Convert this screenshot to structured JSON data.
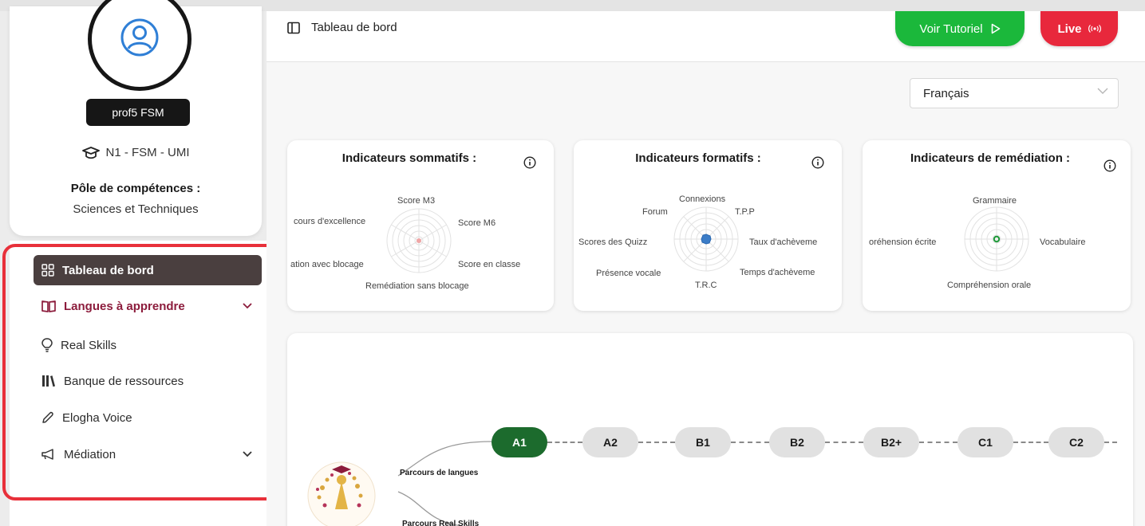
{
  "profile": {
    "username": "prof5 FSM",
    "level_text": "N1 - FSM - UMI",
    "pole_label": "Pôle de compétences :",
    "pole_value": "Sciences et Techniques"
  },
  "sidebar": {
    "items": [
      {
        "label": "Tableau de bord",
        "icon": "grid-icon"
      },
      {
        "label": "Langues à apprendre",
        "icon": "book-open-icon"
      },
      {
        "label": "Real Skills",
        "icon": "lightbulb-icon"
      },
      {
        "label": "Banque de ressources",
        "icon": "library-icon"
      },
      {
        "label": "Elogha Voice",
        "icon": "pen-icon"
      },
      {
        "label": "Médiation",
        "icon": "megaphone-icon"
      }
    ]
  },
  "header": {
    "breadcrumb": "Tableau de bord",
    "tutorial_button": "Voir Tutoriel",
    "live_button": "Live",
    "language_select": "Français"
  },
  "indicators": [
    {
      "title": "Indicateurs sommatifs :",
      "axes": [
        "Score M3",
        "Score M6",
        "Score en classe",
        "Remédiation sans blocage",
        "ation avec blocage",
        "cours d'excellence"
      ]
    },
    {
      "title": "Indicateurs formatifs :",
      "axes": [
        "Connexions",
        "T.P.P",
        "Taux d'achèveme",
        "Temps d'achèveme",
        "T.R.C",
        "Présence vocale",
        "Scores des Quizz",
        "Forum"
      ]
    },
    {
      "title": "Indicateurs de remédiation :",
      "axes": [
        "Grammaire",
        "Vocabulaire",
        "Compréhension orale",
        "oréhension écrite"
      ]
    }
  ],
  "levels": [
    "A1",
    "A2",
    "B1",
    "B2",
    "B2+",
    "C1",
    "C2"
  ],
  "active_level": "A1",
  "paths": {
    "languages": "Parcours de langues",
    "real_skills": "Parcours Real Skills"
  },
  "colors": {
    "active_menu": "#4a3f3f",
    "accent_menu": "#8c1c3c",
    "tutorial_green": "#1bb83b",
    "live_red": "#e8283c",
    "active_level": "#1c6b2d",
    "highlight_border": "#e8303a"
  }
}
